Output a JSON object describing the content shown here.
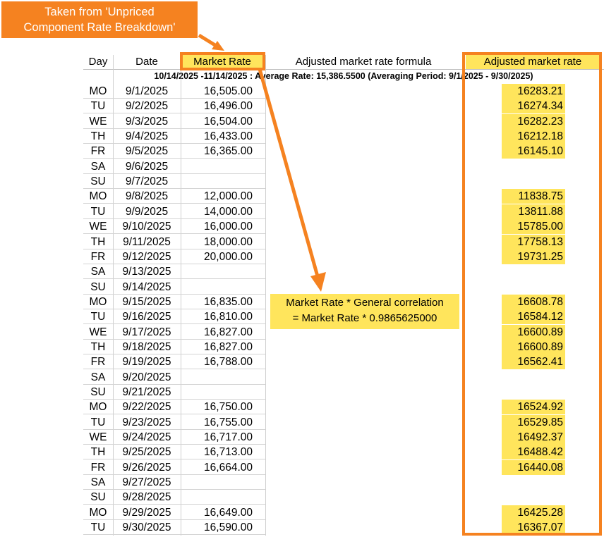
{
  "callout": {
    "line1": "Taken from 'Unpriced",
    "line2": "Component Rate Breakdown'"
  },
  "headers": {
    "day": "Day",
    "date": "Date",
    "market_rate": "Market Rate",
    "formula": "Adjusted market rate formula",
    "adjusted": "Adjusted market rate"
  },
  "summary": "10/14/2025 -11/14/2025 : Average Rate: 15,386.5500 (Averaging Period: 9/1/2025 - 9/30/2025)",
  "formula": {
    "line1": "Market Rate * General correlation",
    "line2": "= Market Rate * 0.9865625000"
  },
  "colors": {
    "accent": "#f58220",
    "highlight": "#ffe55c"
  },
  "rows": [
    {
      "day": "MO",
      "date": "9/1/2025",
      "rate": "16,505.00",
      "adjusted": "16283.21"
    },
    {
      "day": "TU",
      "date": "9/2/2025",
      "rate": "16,496.00",
      "adjusted": "16274.34"
    },
    {
      "day": "WE",
      "date": "9/3/2025",
      "rate": "16,504.00",
      "adjusted": "16282.23"
    },
    {
      "day": "TH",
      "date": "9/4/2025",
      "rate": "16,433.00",
      "adjusted": "16212.18"
    },
    {
      "day": "FR",
      "date": "9/5/2025",
      "rate": "16,365.00",
      "adjusted": "16145.10"
    },
    {
      "day": "SA",
      "date": "9/6/2025",
      "rate": "",
      "adjusted": ""
    },
    {
      "day": "SU",
      "date": "9/7/2025",
      "rate": "",
      "adjusted": ""
    },
    {
      "day": "MO",
      "date": "9/8/2025",
      "rate": "12,000.00",
      "adjusted": "11838.75"
    },
    {
      "day": "TU",
      "date": "9/9/2025",
      "rate": "14,000.00",
      "adjusted": "13811.88"
    },
    {
      "day": "WE",
      "date": "9/10/2025",
      "rate": "16,000.00",
      "adjusted": "15785.00"
    },
    {
      "day": "TH",
      "date": "9/11/2025",
      "rate": "18,000.00",
      "adjusted": "17758.13"
    },
    {
      "day": "FR",
      "date": "9/12/2025",
      "rate": "20,000.00",
      "adjusted": "19731.25"
    },
    {
      "day": "SA",
      "date": "9/13/2025",
      "rate": "",
      "adjusted": ""
    },
    {
      "day": "SU",
      "date": "9/14/2025",
      "rate": "",
      "adjusted": ""
    },
    {
      "day": "MO",
      "date": "9/15/2025",
      "rate": "16,835.00",
      "adjusted": "16608.78"
    },
    {
      "day": "TU",
      "date": "9/16/2025",
      "rate": "16,810.00",
      "adjusted": "16584.12"
    },
    {
      "day": "WE",
      "date": "9/17/2025",
      "rate": "16,827.00",
      "adjusted": "16600.89"
    },
    {
      "day": "TH",
      "date": "9/18/2025",
      "rate": "16,827.00",
      "adjusted": "16600.89"
    },
    {
      "day": "FR",
      "date": "9/19/2025",
      "rate": "16,788.00",
      "adjusted": "16562.41"
    },
    {
      "day": "SA",
      "date": "9/20/2025",
      "rate": "",
      "adjusted": ""
    },
    {
      "day": "SU",
      "date": "9/21/2025",
      "rate": "",
      "adjusted": ""
    },
    {
      "day": "MO",
      "date": "9/22/2025",
      "rate": "16,750.00",
      "adjusted": "16524.92"
    },
    {
      "day": "TU",
      "date": "9/23/2025",
      "rate": "16,755.00",
      "adjusted": "16529.85"
    },
    {
      "day": "WE",
      "date": "9/24/2025",
      "rate": "16,717.00",
      "adjusted": "16492.37"
    },
    {
      "day": "TH",
      "date": "9/25/2025",
      "rate": "16,713.00",
      "adjusted": "16488.42"
    },
    {
      "day": "FR",
      "date": "9/26/2025",
      "rate": "16,664.00",
      "adjusted": "16440.08"
    },
    {
      "day": "SA",
      "date": "9/27/2025",
      "rate": "",
      "adjusted": ""
    },
    {
      "day": "SU",
      "date": "9/28/2025",
      "rate": "",
      "adjusted": ""
    },
    {
      "day": "MO",
      "date": "9/29/2025",
      "rate": "16,649.00",
      "adjusted": "16425.28"
    },
    {
      "day": "TU",
      "date": "9/30/2025",
      "rate": "16,590.00",
      "adjusted": "16367.07"
    }
  ]
}
